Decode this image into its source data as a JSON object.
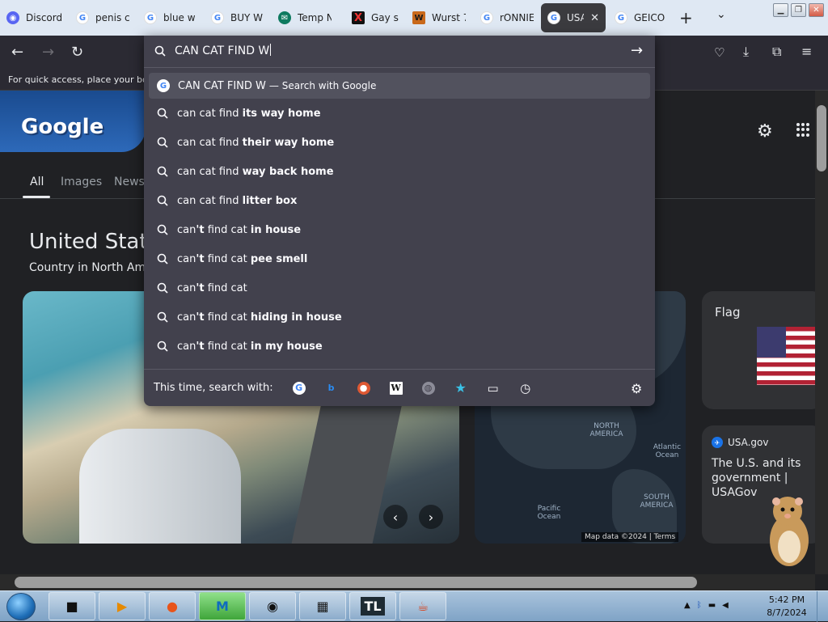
{
  "tabs": [
    {
      "label": "Discord",
      "icon": "discord-icon"
    },
    {
      "label": "penis c",
      "icon": "google-icon"
    },
    {
      "label": "blue w",
      "icon": "google-icon"
    },
    {
      "label": "BUY W",
      "icon": "google-icon"
    },
    {
      "label": "Temp N",
      "icon": "temp-mail-icon"
    },
    {
      "label": "Gay st",
      "icon": "x-icon"
    },
    {
      "label": "Wurst 7",
      "icon": "wurst-icon"
    },
    {
      "label": "rONNIE",
      "icon": "google-icon"
    },
    {
      "label": "USA",
      "icon": "google-icon",
      "active": true
    },
    {
      "label": "GEICO",
      "icon": "google-icon"
    }
  ],
  "bookmarks_bar": {
    "text": "For quick access, place your boo"
  },
  "urlbar": {
    "value": "CAN CAT FIND W"
  },
  "suggestions": [
    {
      "plain": "CAN CAT FIND W",
      "bold": "",
      "suffix": "— Search with Google",
      "type": "google"
    },
    {
      "plain": "can cat find ",
      "bold": "its way home"
    },
    {
      "plain": "can cat find ",
      "bold": "their way home"
    },
    {
      "plain": "can cat find ",
      "bold": "way back home"
    },
    {
      "plain": "can cat find ",
      "bold": "litter box"
    },
    {
      "plain": "can",
      "bold2": "'t",
      "plain2": " find cat ",
      "bold": "in house"
    },
    {
      "plain": "can",
      "bold2": "'t",
      "plain2": " find cat ",
      "bold": "pee smell"
    },
    {
      "plain": "can",
      "bold2": "'t",
      "plain2": " find cat",
      "bold": ""
    },
    {
      "plain": "can",
      "bold2": "'t",
      "plain2": " find cat ",
      "bold": "hiding in house"
    },
    {
      "plain": "can",
      "bold2": "'t",
      "plain2": " find cat ",
      "bold": "in my house"
    }
  ],
  "search_with": {
    "label": "This time, search with:"
  },
  "page": {
    "search_tabs": [
      "All",
      "Images",
      "News"
    ],
    "entity_title": "United State",
    "entity_subtitle": "Country in North Amer",
    "flag_card_title": "Flag",
    "usagov_source": "USA.gov",
    "usagov_desc": "The U.S. and its government | USAGov",
    "map_labels": {
      "north_america": "NORTH AMERICA",
      "south_america": "SOUTH AMERICA",
      "atlantic": "Atlantic Ocean",
      "pacific": "Pacific Ocean"
    },
    "map_data": "Map data ©2024",
    "map_terms": "Terms",
    "doodle_text": "Google"
  },
  "taskbar": {
    "time": "5:42 PM",
    "date": "8/7/2024",
    "tl_label": "TL"
  }
}
